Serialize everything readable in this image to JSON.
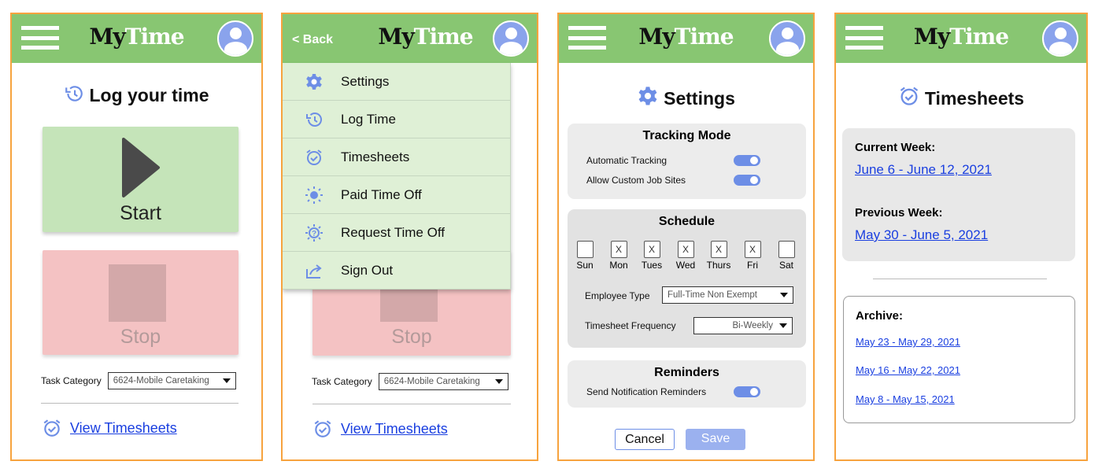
{
  "app": {
    "logo_my": "My",
    "logo_time": "Time"
  },
  "screen1": {
    "title": "Log your time",
    "start_label": "Start",
    "stop_label": "Stop",
    "task_label": "Task Category",
    "task_value": "6624-Mobile Caretaking",
    "view_link": "View Timesheets"
  },
  "screen2": {
    "back_label": "< Back",
    "menu": [
      {
        "label": "Settings",
        "icon": "gear-icon"
      },
      {
        "label": "Log Time",
        "icon": "history-icon"
      },
      {
        "label": "Timesheets",
        "icon": "alarm-check-icon"
      },
      {
        "label": "Paid Time Off",
        "icon": "sun-icon"
      },
      {
        "label": "Request Time Off",
        "icon": "sun-question-icon"
      },
      {
        "label": "Sign Out",
        "icon": "share-out-icon"
      }
    ],
    "stop_label": "Stop",
    "task_label": "Task Category",
    "task_value": "6624-Mobile Caretaking",
    "view_link": "View Timesheets"
  },
  "screen3": {
    "title": "Settings",
    "tracking": {
      "title": "Tracking Mode",
      "items": [
        {
          "label": "Automatic Tracking",
          "on": true
        },
        {
          "label": "Allow Custom Job Sites",
          "on": true
        }
      ]
    },
    "schedule": {
      "title": "Schedule",
      "days": [
        {
          "label": "Sun",
          "mark": ""
        },
        {
          "label": "Mon",
          "mark": "X"
        },
        {
          "label": "Tues",
          "mark": "X"
        },
        {
          "label": "Wed",
          "mark": "X"
        },
        {
          "label": "Thurs",
          "mark": "X"
        },
        {
          "label": "Fri",
          "mark": "X"
        },
        {
          "label": "Sat",
          "mark": ""
        }
      ],
      "employee_type_label": "Employee Type",
      "employee_type_value": "Full-Time Non Exempt",
      "frequency_label": "Timesheet Frequency",
      "frequency_value": "Bi-Weekly"
    },
    "reminders": {
      "title": "Reminders",
      "label": "Send Notification Reminders",
      "on": true
    },
    "cancel_label": "Cancel",
    "save_label": "Save"
  },
  "screen4": {
    "title": "Timesheets",
    "current_label": "Current Week:",
    "current_link": "June 6 - June 12, 2021",
    "previous_label": "Previous Week:",
    "previous_link": "May 30 - June 5, 2021",
    "archive_label": "Archive:",
    "archive": [
      "May 23 - May 29, 2021",
      "May 16 - May 22, 2021",
      "May 8 - May 15, 2021"
    ]
  },
  "colors": {
    "header": "#88c672",
    "accent": "#6d8ee6",
    "link": "#1a3fe0",
    "frame": "#f7a33e"
  }
}
